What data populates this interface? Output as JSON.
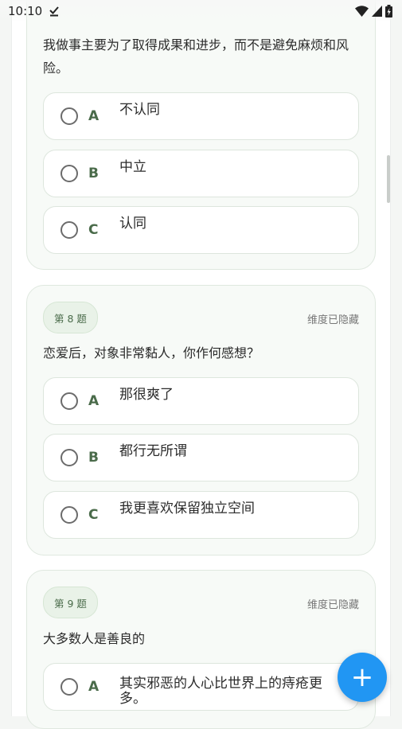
{
  "status_bar": {
    "time": "10:10"
  },
  "questions": [
    {
      "text": "我做事主要为了取得成果和进步，而不是避免麻烦和风险。",
      "options": [
        {
          "letter": "A",
          "label": "不认同"
        },
        {
          "letter": "B",
          "label": "中立"
        },
        {
          "letter": "C",
          "label": "认同"
        }
      ]
    },
    {
      "number_label": "第 8 题",
      "dimension_label": "维度已隐藏",
      "text": "恋爱后，对象非常黏人，你作何感想？",
      "options": [
        {
          "letter": "A",
          "label": "那很爽了"
        },
        {
          "letter": "B",
          "label": "都行无所谓"
        },
        {
          "letter": "C",
          "label": "我更喜欢保留独立空间"
        }
      ]
    },
    {
      "number_label": "第 9 题",
      "dimension_label": "维度已隐藏",
      "text": "大多数人是善良的",
      "options": [
        {
          "letter": "A",
          "label": "其实邪恶的人心比世界上的痔疮更多。"
        }
      ]
    }
  ],
  "fab": {
    "label": "+"
  },
  "colors": {
    "accent": "#2196f3",
    "option_letter": "#4a6b4a",
    "card_bg": "#f7faf7"
  }
}
